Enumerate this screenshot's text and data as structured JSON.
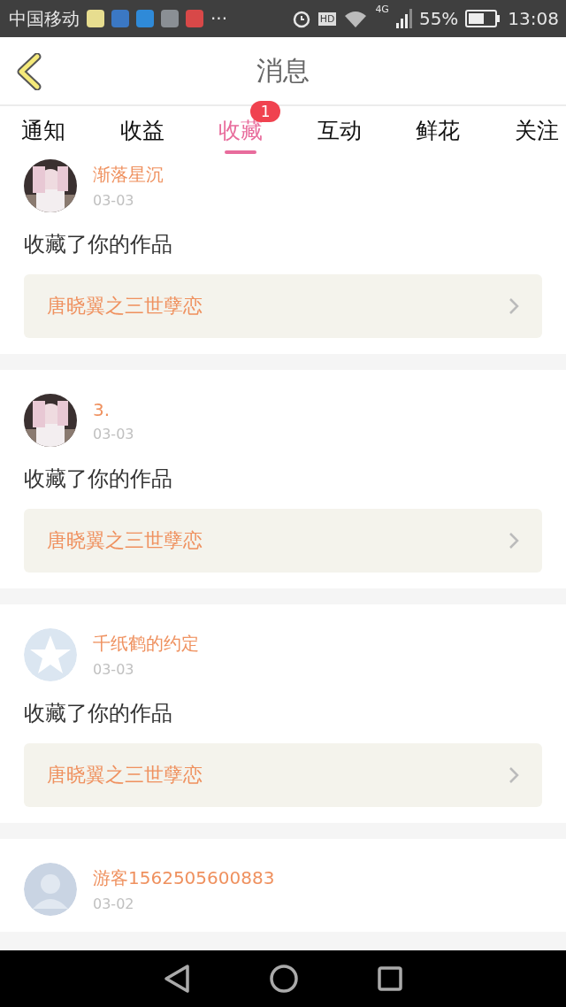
{
  "status_bar": {
    "carrier": "中国移动",
    "more": "···",
    "hd": "HD",
    "network": "4G",
    "battery": "55%",
    "time": "13:08"
  },
  "header": {
    "title": "消息"
  },
  "tabs": [
    {
      "label": "通知",
      "selected": false
    },
    {
      "label": "收益",
      "selected": false
    },
    {
      "label": "收藏",
      "selected": true,
      "badge": "1"
    },
    {
      "label": "互动",
      "selected": false
    },
    {
      "label": "鲜花",
      "selected": false
    },
    {
      "label": "关注",
      "selected": false
    }
  ],
  "messages": [
    {
      "name": "渐落星沉",
      "date": "03-03",
      "text": "收藏了你的作品",
      "work": "唐晓翼之三世孽恋"
    },
    {
      "name": "3.",
      "date": "03-03",
      "text": "收藏了你的作品",
      "work": "唐晓翼之三世孽恋"
    },
    {
      "avatar": {
        "kind": "star"
      },
      "name": "千纸鹤的约定",
      "date": "03-03",
      "text": "收藏了你的作品",
      "work": "唐晓翼之三世孽恋"
    },
    {
      "avatar": {
        "kind": "silhouette"
      },
      "name": "游客1562505600883",
      "date": "03-02"
    }
  ]
}
